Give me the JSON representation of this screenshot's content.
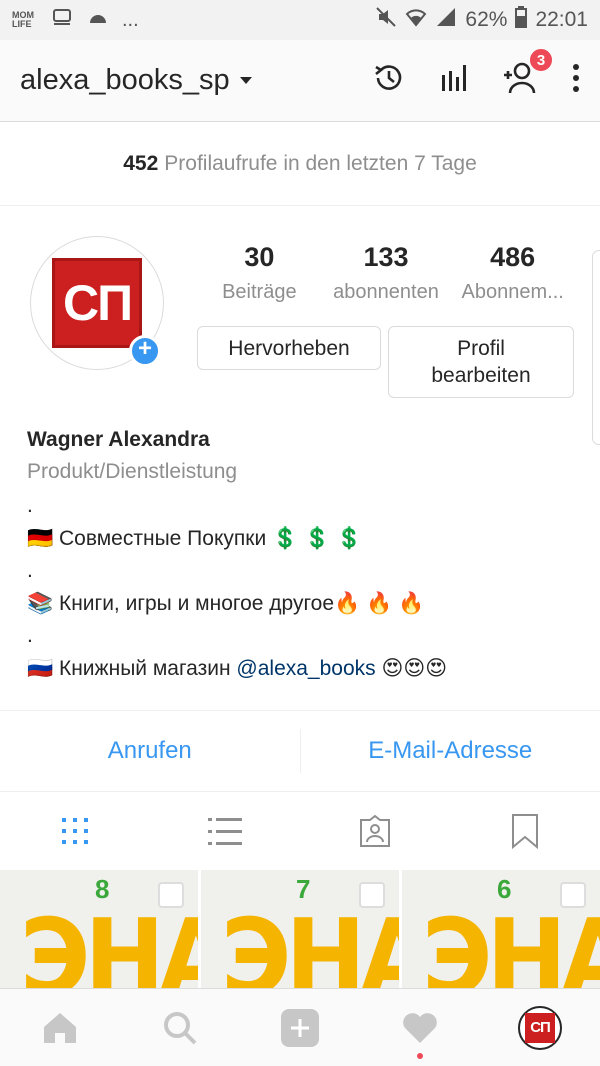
{
  "statusbar": {
    "left_label": "MOM LIFE",
    "ellipsis": "...",
    "battery": "62%",
    "time": "22:01"
  },
  "appbar": {
    "username": "alexa_books_sp",
    "notification_count": "3",
    "icons": [
      "history-icon",
      "insights-icon",
      "discover-people-icon",
      "more-icon"
    ]
  },
  "profile_views": {
    "count": "452",
    "text": "Profilaufrufe in den letzten 7 Tage"
  },
  "profile": {
    "avatar_text": "СП",
    "stats": [
      {
        "number": "30",
        "label": "Beiträge"
      },
      {
        "number": "133",
        "label": "abonnenten"
      },
      {
        "number": "486",
        "label": "Abonnem..."
      }
    ],
    "highlight_button": "Hervorheben",
    "edit_button_line1": "Profil",
    "edit_button_line2": "bearbeiten"
  },
  "bio": {
    "name": "Wagner Alexandra",
    "category": "Produkt/Dienstleistung",
    "dot1": ".",
    "line1": "🇩🇪 Совместные Покупки 💲 💲 💲",
    "dot2": ".",
    "line2": "📚 Книги, игры и многое другое🔥 🔥 🔥",
    "dot3": ".",
    "line3_prefix": "🇷🇺 Книжный магазин ",
    "line3_mention": "@alexa_books",
    "line3_suffix": " 😍😍😍"
  },
  "contact": {
    "call": "Anrufen",
    "email": "E-Mail-Adresse"
  },
  "tabs": [
    "grid-tab",
    "list-tab",
    "tagged-tab",
    "saved-tab"
  ],
  "grid": [
    {
      "number": "8",
      "word": "ЭНАС"
    },
    {
      "number": "7",
      "word": "ЭНАС"
    },
    {
      "number": "6",
      "word": "ЭНАС"
    }
  ],
  "colors": {
    "accent_blue": "#3897f0",
    "badge_red": "#ed4956",
    "logo_red": "#cc1f1f",
    "grid_yellow": "#f5b400",
    "grid_green": "#3aa83a"
  },
  "bottomnav": {
    "items": [
      "home-icon",
      "search-icon",
      "add-icon",
      "activity-icon",
      "profile-avatar"
    ],
    "avatar_text": "СП"
  }
}
